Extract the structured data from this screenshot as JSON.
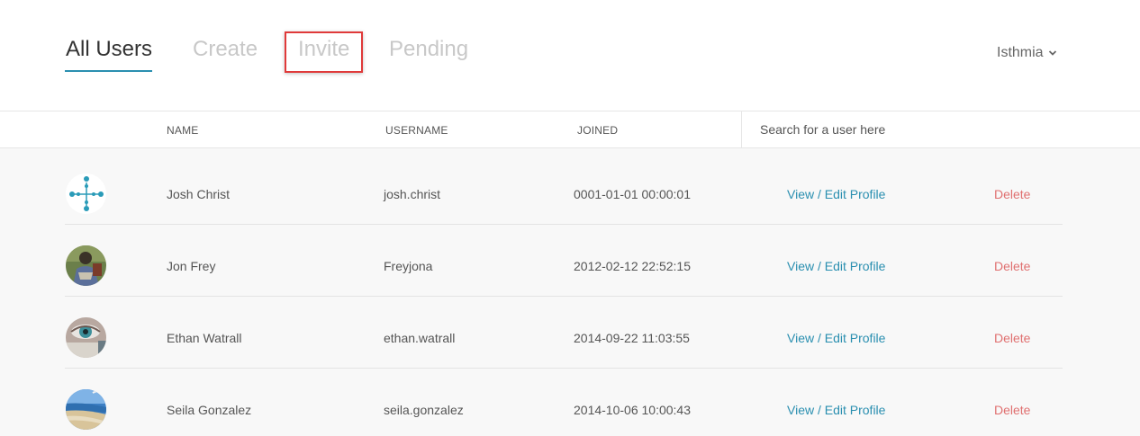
{
  "tabs": [
    {
      "label": "All Users",
      "active": true
    },
    {
      "label": "Create",
      "active": false
    },
    {
      "label": "Invite",
      "active": false
    },
    {
      "label": "Pending",
      "active": false
    }
  ],
  "account": {
    "name": "Isthmia"
  },
  "table": {
    "headers": {
      "name": "NAME",
      "username": "USERNAME",
      "joined": "JOINED"
    },
    "search_placeholder": "Search for a user here",
    "rows": [
      {
        "name": "Josh Christ",
        "username": "josh.christ",
        "joined": "0001-01-01 00:00:01",
        "edit": "View / Edit Profile",
        "delete": "Delete"
      },
      {
        "name": "Jon Frey",
        "username": "Freyjona",
        "joined": "2012-02-12 22:52:15",
        "edit": "View / Edit Profile",
        "delete": "Delete"
      },
      {
        "name": "Ethan Watrall",
        "username": "ethan.watrall",
        "joined": "2014-09-22 11:03:55",
        "edit": "View / Edit Profile",
        "delete": "Delete"
      },
      {
        "name": "Seila Gonzalez",
        "username": "seila.gonzalez",
        "joined": "2014-10-06 10:00:43",
        "edit": "View / Edit Profile",
        "delete": "Delete"
      }
    ]
  },
  "colors": {
    "accent": "#2a8fb0",
    "danger": "#e07070",
    "highlight": "#e03a3a"
  }
}
